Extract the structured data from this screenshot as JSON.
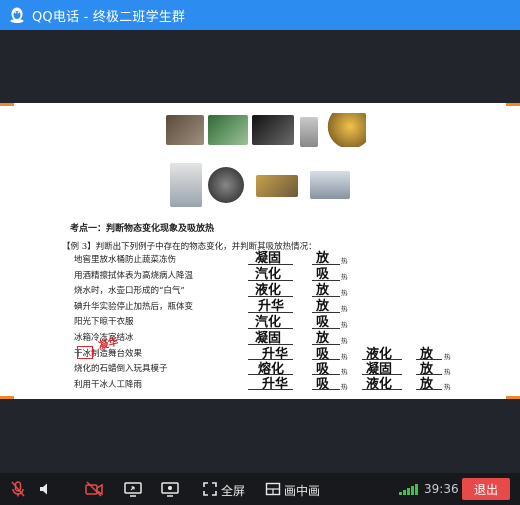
{
  "window": {
    "title": "QQ电话 - 终极二班学生群"
  },
  "slide": {
    "section_title": "考点一：判断物态变化现象及吸放热",
    "example": "【例 3】判断出下列例子中存在的物态变化，并判断其吸放热情况：",
    "rows": [
      "地窖里放水桶防止蔬菜冻伤",
      "用酒精擦拭体表为高烧病人降温",
      "烧水时，水壶口形成的“白气”",
      "碘升华实验停止加热后，瓶体变",
      "阳光下晾干衣服",
      "冰箱冷冻室结冰",
      "干冰制造舞台效果",
      "烧化的石蜡倒入玩具模子",
      "利用干冰人工降雨"
    ],
    "answers_col1": [
      "凝固",
      "汽化",
      "液化",
      "升华",
      "汽化",
      "凝固",
      "升华",
      "熔化",
      "升华"
    ],
    "answers_col2": [
      "放",
      "吸",
      "放",
      "放",
      "吸",
      "放",
      "吸",
      "吸",
      "吸"
    ],
    "answers_col3": [
      "液化",
      "凝固",
      "液化"
    ],
    "answers_col4": [
      "放",
      "放",
      "放"
    ],
    "heat_suffix": "热",
    "annotation_red": "凝华"
  },
  "toolbar": {
    "fullscreen_label": "全屏",
    "pip_label": "画中画",
    "timer": "39:36",
    "exit_label": "退出"
  },
  "colors": {
    "titlebar": "#2d8cf0",
    "exit": "#e84a4a",
    "accent_corner": "#f08a24",
    "signal": "#3fc14a",
    "mute_red": "#e84a4a"
  }
}
